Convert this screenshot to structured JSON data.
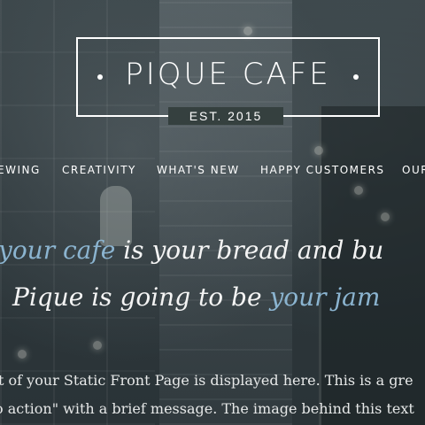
{
  "header": {
    "logo_title": "PIQUE CAFE",
    "logo_est": "EST. 2015"
  },
  "nav": {
    "items": [
      "EWING",
      "CREATIVITY",
      "WHAT'S NEW",
      "HAPPY CUSTOMERS",
      "OUR"
    ]
  },
  "hero": {
    "line1_part1": "your cafe",
    "line1_part2": " is your bread and bu",
    "line2_part1": "Pique is going to be ",
    "line2_part2": "your jam",
    "body_line1": "t of your Static Front Page is displayed here. This is a gre",
    "body_line2": "o action\" with a brief message. The image behind this text"
  },
  "colors": {
    "accent": "#8bb4d0",
    "text": "#ffffff",
    "background": "#2f3a3f"
  }
}
